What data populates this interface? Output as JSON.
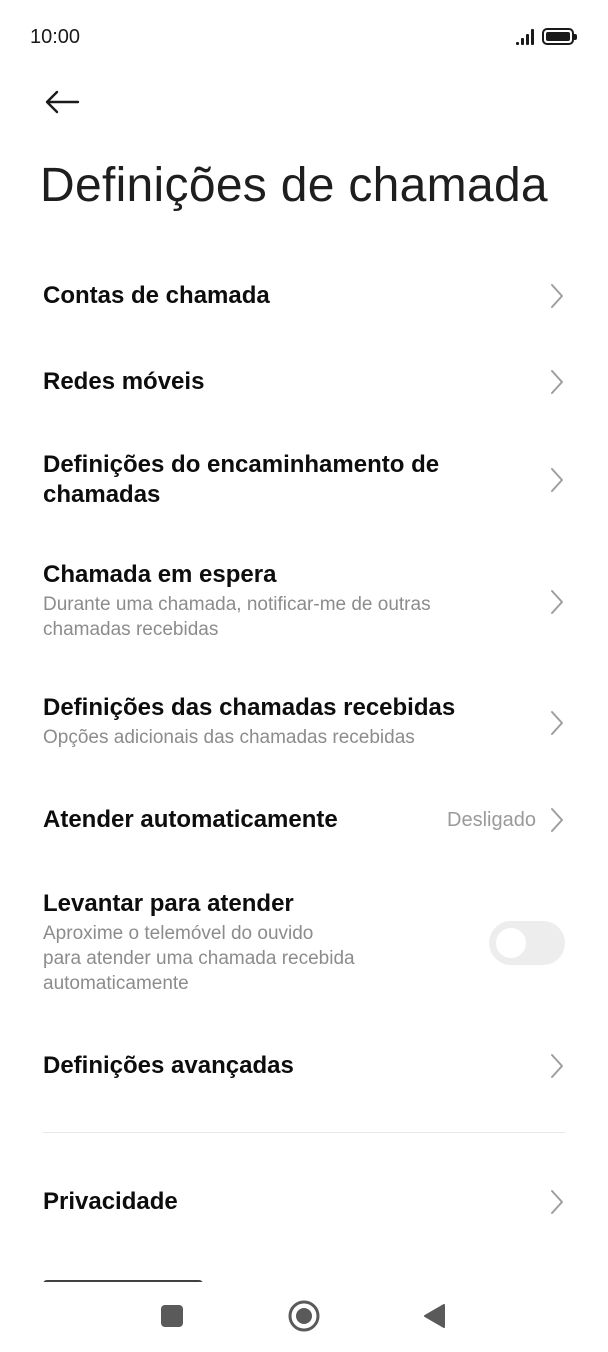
{
  "status_bar": {
    "time": "10:00",
    "signal_icon": "signal-icon",
    "battery_icon": "battery-icon"
  },
  "header": {
    "back_icon": "arrow-left-icon",
    "title": "Definições de chamada"
  },
  "settings": {
    "calling_accounts": {
      "title": "Contas de chamada"
    },
    "mobile_networks": {
      "title": "Redes móveis"
    },
    "call_forwarding": {
      "title_line1": "Definições do encaminhamento de",
      "title_line2": "chamadas"
    },
    "call_waiting": {
      "title": "Chamada em espera",
      "subtitle_line1": "Durante uma chamada, notificar-me de outras",
      "subtitle_line2": "chamadas recebidas"
    },
    "incoming_calls": {
      "title": "Definições das chamadas recebidas",
      "subtitle": "Opções adicionais das chamadas recebidas"
    },
    "auto_answer": {
      "title": "Atender automaticamente",
      "value": "Desligado"
    },
    "raise_to_answer": {
      "title": "Levantar para atender",
      "subtitle_line1": "Aproxime o telemóvel do ouvido",
      "subtitle_line2": "para atender uma chamada recebida",
      "subtitle_line3": "automaticamente",
      "enabled": false
    },
    "advanced": {
      "title": "Definições avançadas"
    },
    "privacy": {
      "title": "Privacidade"
    }
  },
  "nav_bar": {
    "recents_icon": "square-icon",
    "home_icon": "circle-icon",
    "back_icon": "triangle-back-icon"
  },
  "colors": {
    "title": "#1e1e1e",
    "text": "#0d0d0d",
    "secondary": "#8c8c8c",
    "chevron": "#9e9e9e",
    "toggle_off": "#ededed",
    "nav_icon": "#5a5a5a"
  }
}
